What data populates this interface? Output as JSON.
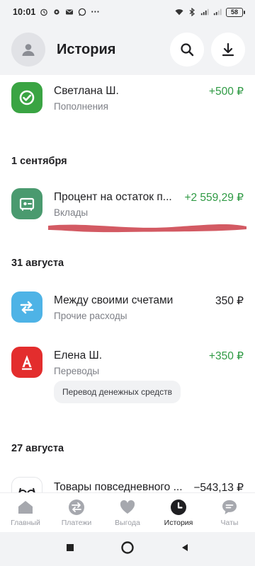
{
  "status_bar": {
    "time": "10:01",
    "notification_icons": [
      "alarm-icon",
      "settings-icon",
      "mail-icon",
      "whatsapp-icon"
    ],
    "more": "···",
    "battery": "58"
  },
  "header": {
    "title": "История"
  },
  "transactions": [
    {
      "title": "Светлана Ш.",
      "subtitle": "Пополнения",
      "amount": "+500 ₽",
      "positive": true,
      "icon": "checkmark-icon",
      "color": "#3aa443"
    },
    {
      "title": "Процент на остаток п...",
      "subtitle": "Вклады",
      "amount": "+2 559,29 ₽",
      "positive": true,
      "icon": "deposit-icon",
      "color": "#4a9a6f"
    },
    {
      "title": "Между своими счетами",
      "subtitle": "Прочие расходы",
      "amount": "350 ₽",
      "positive": false,
      "icon": "transfer-arrows-icon",
      "color": "#4eb3e6"
    },
    {
      "title": "Елена Ш.",
      "subtitle": "Переводы",
      "amount": "+350 ₽",
      "positive": true,
      "icon": "alfa-bank-icon",
      "color": "#e32d2d"
    },
    {
      "title": "Товары повседневного ...",
      "subtitle": "",
      "amount": "−543,13 ₽",
      "positive": false,
      "icon": "glasses-icon",
      "color": "#ffffff"
    }
  ],
  "date_groups": [
    "1 сентября",
    "31 августа",
    "27 августа"
  ],
  "tag": "Перевод денежных средств",
  "tabs": [
    {
      "label": "Главный",
      "icon": "home-icon",
      "active": false
    },
    {
      "label": "Платежи",
      "icon": "payments-icon",
      "active": false
    },
    {
      "label": "Выгода",
      "icon": "heart-icon",
      "active": false
    },
    {
      "label": "История",
      "icon": "clock-icon",
      "active": true
    },
    {
      "label": "Чаты",
      "icon": "chat-icon",
      "active": false
    }
  ],
  "colors": {
    "positive": "#2f9a44",
    "redaction": "#d35a63",
    "active_tab": "#1f1f22",
    "inactive_tab": "#9a9ca3"
  }
}
